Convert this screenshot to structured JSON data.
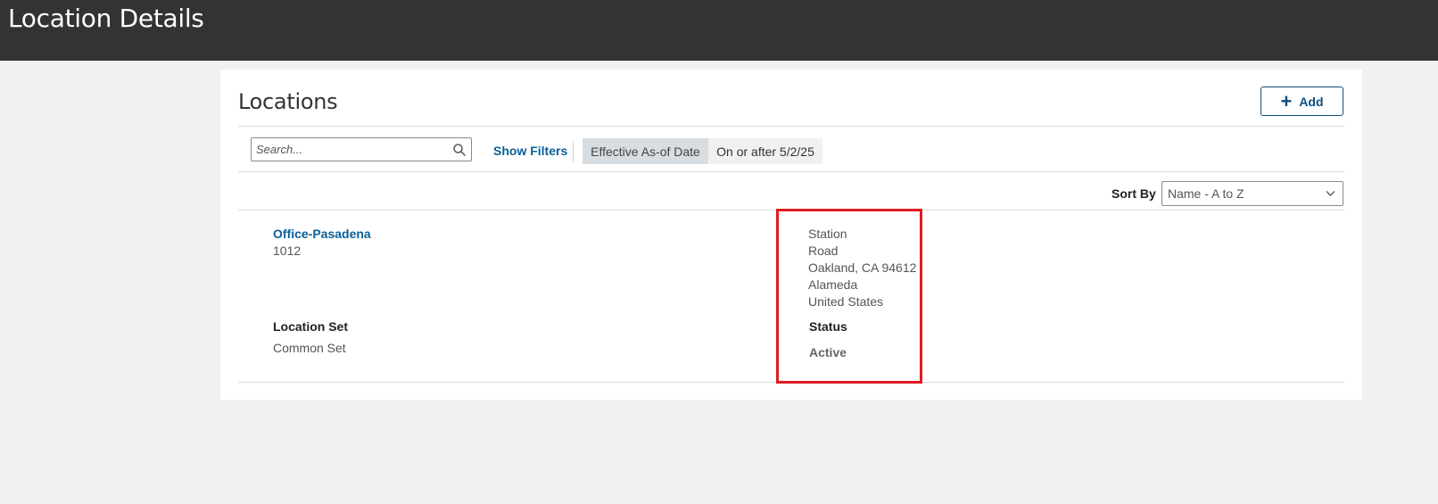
{
  "header": {
    "title": "Location Details"
  },
  "panel": {
    "title": "Locations",
    "add_label": "Add",
    "search": {
      "placeholder": "Search...",
      "value": ""
    },
    "show_filters_label": "Show Filters",
    "filter_chip": {
      "label": "Effective As-of Date",
      "value": "On or after 5/2/25"
    },
    "sort": {
      "label": "Sort By",
      "selected": "Name - A to Z"
    }
  },
  "record": {
    "name": "Office-Pasadena",
    "code": "1012",
    "address_lines": [
      "Station",
      "Road",
      "Oakland, CA 94612",
      "Alameda",
      "United States"
    ],
    "location_set_label": "Location Set",
    "location_set_value": "Common Set",
    "status_label": "Status",
    "status_value": "Active"
  },
  "colors": {
    "header_bg": "#333333",
    "link": "#0b5f98",
    "highlight": "#e01b24"
  },
  "icons": {
    "search": "search-icon",
    "add": "plus-icon",
    "sort": "chevron-down-icon"
  }
}
